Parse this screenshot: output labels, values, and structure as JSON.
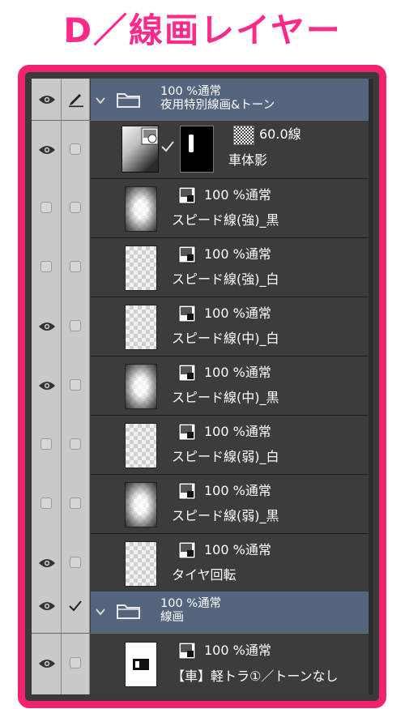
{
  "heading": "D／線画レイヤー",
  "colors": {
    "accent": "#f0246e",
    "heading": "#ff2a8a",
    "folder_bg": "#56657e",
    "panel_bg": "#3c3c3c"
  },
  "folder1": {
    "opacity_mode": "100 %通常",
    "name": "夜用特別線画&トーン",
    "visible": true,
    "icon": "folder-icon"
  },
  "mask_layer": {
    "opacity_mode": "60.0線",
    "name": "車体影",
    "visible": true
  },
  "layers": [
    {
      "opacity_mode": "100 %通常",
      "name": "スピード線(強)_黒",
      "visible": false
    },
    {
      "opacity_mode": "100 %通常",
      "name": "スピード線(強)_白",
      "visible": false
    },
    {
      "opacity_mode": "100 %通常",
      "name": "スピード線(中)_白",
      "visible": true
    },
    {
      "opacity_mode": "100 %通常",
      "name": "スピード線(中)_黒",
      "visible": true
    },
    {
      "opacity_mode": "100 %通常",
      "name": "スピード線(弱)_白",
      "visible": false
    },
    {
      "opacity_mode": "100 %通常",
      "name": "スピード線(弱)_黒",
      "visible": false
    },
    {
      "opacity_mode": "100 %通常",
      "name": "タイヤ回転",
      "visible": true
    }
  ],
  "folder2": {
    "opacity_mode": "100 %通常",
    "name": "線画",
    "visible": true,
    "icon": "folder-icon"
  },
  "last_layer": {
    "opacity_mode": "100 %通常",
    "name": "【車】軽トラ①／トーンなし",
    "visible": true
  }
}
